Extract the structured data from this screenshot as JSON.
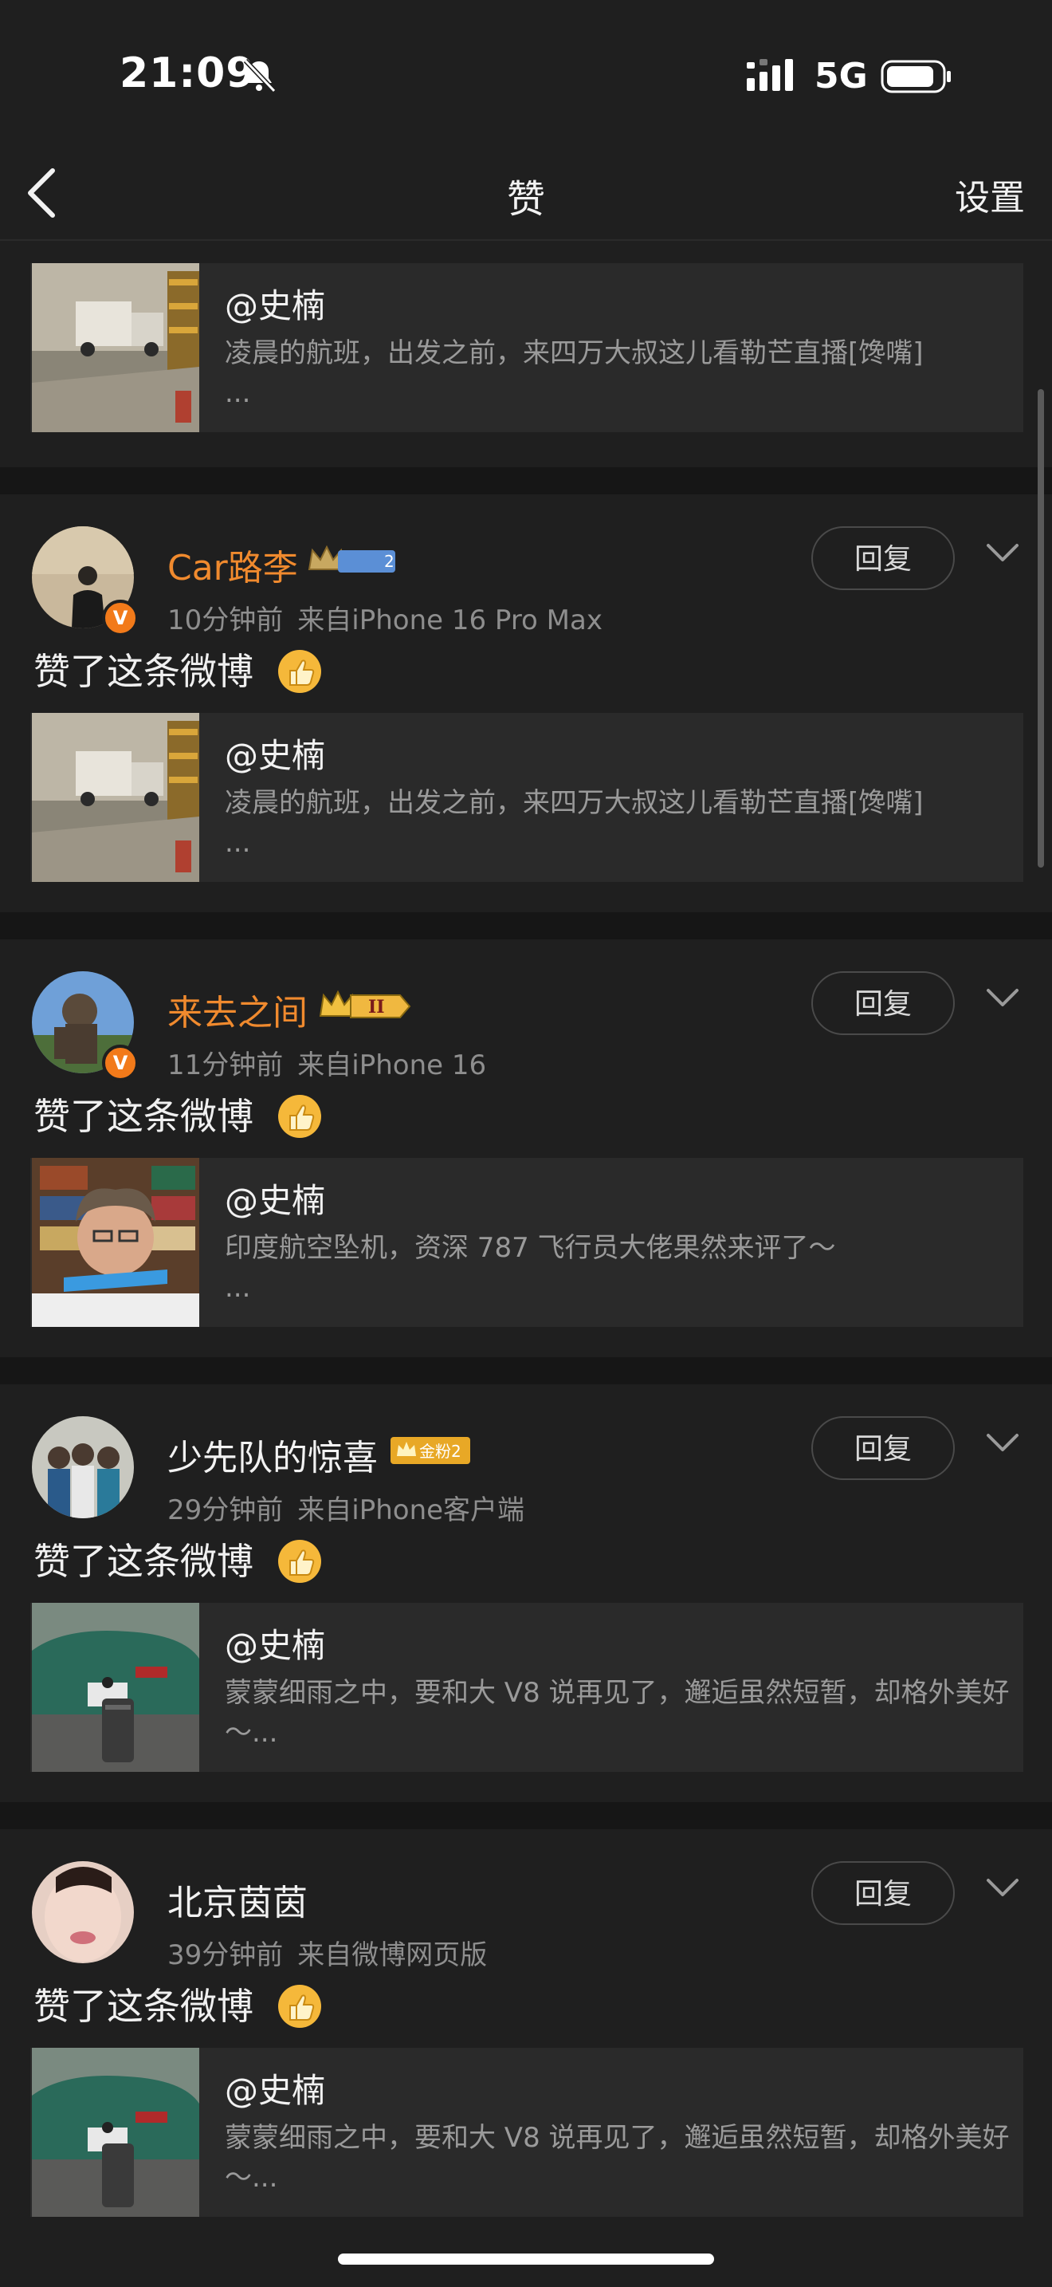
{
  "status_bar": {
    "time": "21:09",
    "network": "5G"
  },
  "nav": {
    "title": "赞",
    "settings": "设置"
  },
  "top_quote": {
    "author": "@史楠",
    "text": "凌晨的航班，出发之前，来四万大叔这儿看勒芒直播[馋嘴]\n..."
  },
  "items": [
    {
      "name": "Car路李",
      "time": "10分钟前",
      "source": "来自iPhone 16 Pro Max",
      "action": "赞了这条微博",
      "reply": "回复",
      "quote_author": "@史楠",
      "quote_text": "凌晨的航班，出发之前，来四万大叔这儿看勒芒直播[馋嘴]\n...",
      "badge_text": "2"
    },
    {
      "name": "来去之间",
      "time": "11分钟前",
      "source": "来自iPhone 16",
      "action": "赞了这条微博",
      "reply": "回复",
      "quote_author": "@史楠",
      "quote_text": "印度航空坠机，资深 787 飞行员大佬果然来评了～\n...",
      "badge_text": "II"
    },
    {
      "name": "少先队的惊喜",
      "time": "29分钟前",
      "source": "来自iPhone客户端",
      "action": "赞了这条微博",
      "reply": "回复",
      "quote_author": "@史楠",
      "quote_text": "蒙蒙细雨之中，要和大 V8 说再见了，邂逅虽然短暂，却格外美好～...",
      "badge_text": "金粉2"
    },
    {
      "name": "北京茵茵",
      "time": "39分钟前",
      "source": "来自微博网页版",
      "action": "赞了这条微博",
      "reply": "回复",
      "quote_author": "@史楠",
      "quote_text": "蒙蒙细雨之中，要和大 V8 说再见了，邂逅虽然短暂，却格外美好～..."
    }
  ],
  "colors": {
    "background": "#1f1f1f",
    "separator": "#161616",
    "orange_name": "#f08a2e",
    "card": "#2a2a2a"
  }
}
